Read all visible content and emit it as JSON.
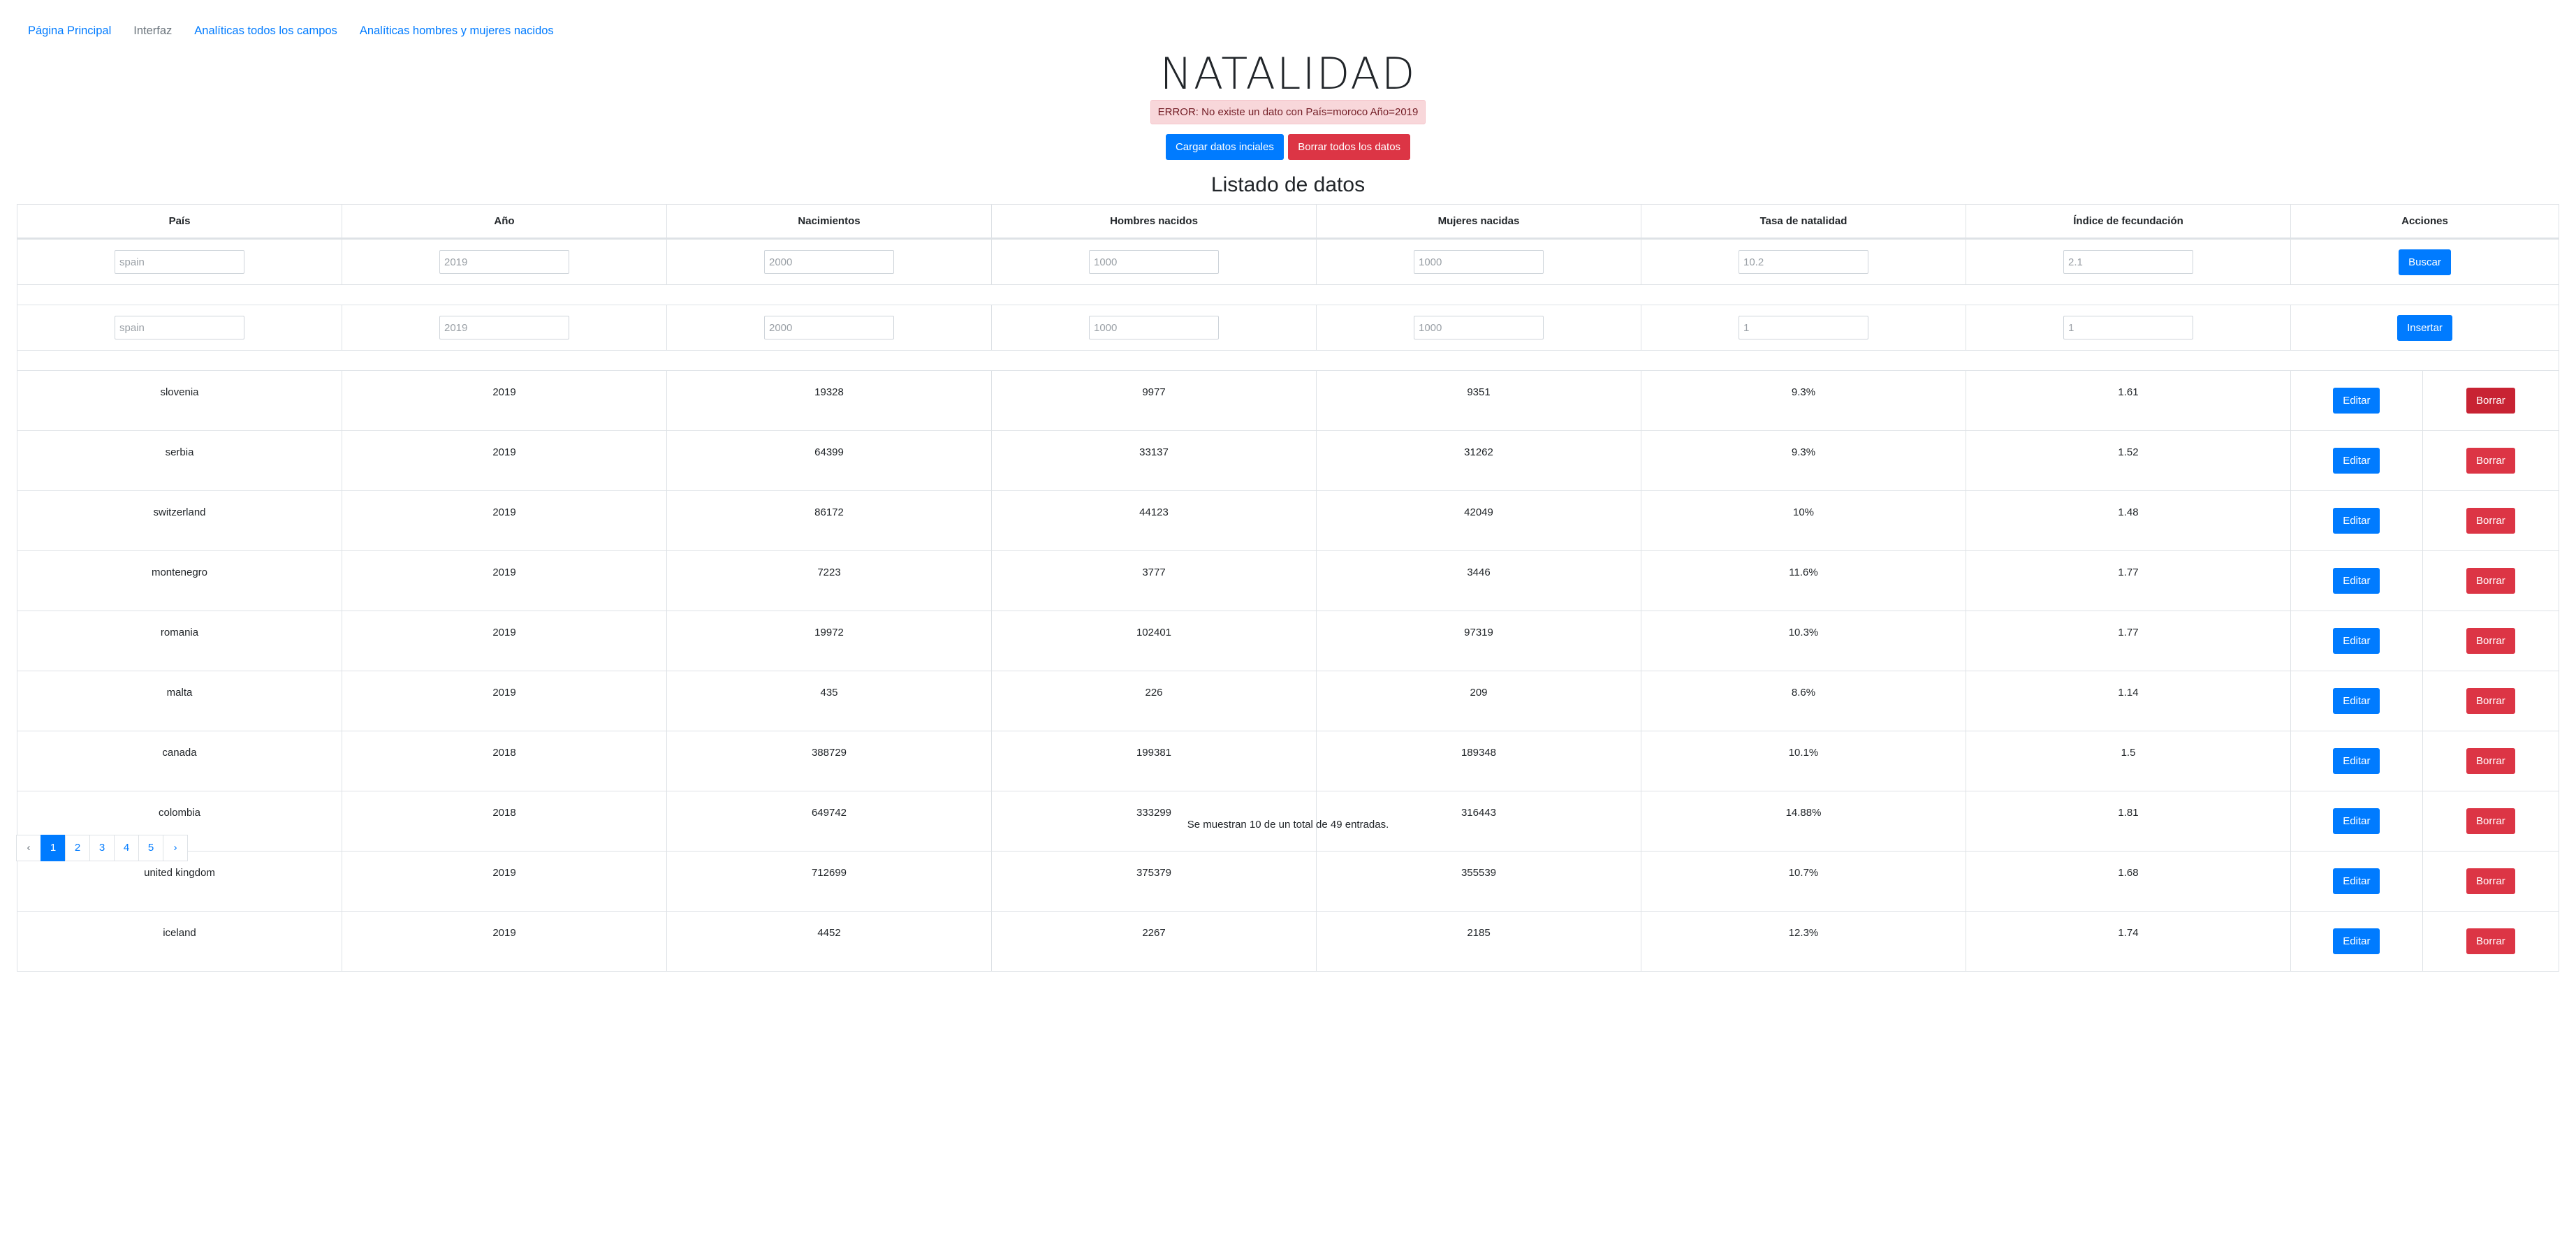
{
  "nav": {
    "items": [
      {
        "label": "Página Principal",
        "muted": false
      },
      {
        "label": "Interfaz",
        "muted": true
      },
      {
        "label": "Analíticas todos los campos",
        "muted": false
      },
      {
        "label": "Analíticas hombres y mujeres nacidos",
        "muted": false
      }
    ]
  },
  "title": "NATALIDAD",
  "alert": "ERROR: No existe un dato con País=moroco Año=2019",
  "actions": {
    "load_label": "Cargar datos inciales",
    "delete_all_label": "Borrar todos los datos"
  },
  "subtitle": "Listado de datos",
  "table": {
    "headers": [
      "País",
      "Año",
      "Nacimientos",
      "Hombres nacidos",
      "Mujeres nacidas",
      "Tasa de natalidad",
      "Índice de fecundación",
      "Acciones"
    ],
    "search_row": {
      "placeholders": [
        "spain",
        "2019",
        "2000",
        "1000",
        "1000",
        "10.2",
        "2.1"
      ],
      "button": "Buscar"
    },
    "insert_row": {
      "placeholders": [
        "spain",
        "2019",
        "2000",
        "1000",
        "1000",
        "1",
        "1"
      ],
      "button": "Insertar"
    },
    "edit_label": "Editar",
    "delete_label": "Borrar",
    "rows": [
      [
        "slovenia",
        "2019",
        "19328",
        "9977",
        "9351",
        "9.3%",
        "1.61"
      ],
      [
        "serbia",
        "2019",
        "64399",
        "33137",
        "31262",
        "9.3%",
        "1.52"
      ],
      [
        "switzerland",
        "2019",
        "86172",
        "44123",
        "42049",
        "10%",
        "1.48"
      ],
      [
        "montenegro",
        "2019",
        "7223",
        "3777",
        "3446",
        "11.6%",
        "1.77"
      ],
      [
        "romania",
        "2019",
        "19972",
        "102401",
        "97319",
        "10.3%",
        "1.77"
      ],
      [
        "malta",
        "2019",
        "435",
        "226",
        "209",
        "8.6%",
        "1.14"
      ],
      [
        "canada",
        "2018",
        "388729",
        "199381",
        "189348",
        "10.1%",
        "1.5"
      ],
      [
        "colombia",
        "2018",
        "649742",
        "333299",
        "316443",
        "14.88%",
        "1.81"
      ],
      [
        "united kingdom",
        "2019",
        "712699",
        "375379",
        "355539",
        "10.7%",
        "1.68"
      ],
      [
        "iceland",
        "2019",
        "4452",
        "2267",
        "2185",
        "12.3%",
        "1.74"
      ]
    ]
  },
  "footer": "Se muestran 10 de un total de 49 entradas.",
  "pagination": {
    "prev": "‹",
    "next": "›",
    "pages": [
      "1",
      "2",
      "3",
      "4",
      "5"
    ],
    "active": "1"
  }
}
